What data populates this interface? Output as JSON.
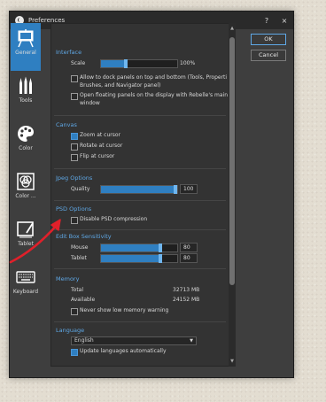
{
  "window": {
    "title": "Preferences",
    "help": "?",
    "close": "×"
  },
  "sidebar": {
    "items": [
      {
        "label": "General",
        "icon": "easel-icon"
      },
      {
        "label": "Tools",
        "icon": "brushes-icon"
      },
      {
        "label": "Color",
        "icon": "palette-icon"
      },
      {
        "label": "Color ...",
        "icon": "color-mix-icon"
      },
      {
        "label": "Tablet",
        "icon": "tablet-icon"
      },
      {
        "label": "Keyboard",
        "icon": "keyboard-icon"
      }
    ]
  },
  "interface": {
    "heading": "Interface",
    "scale_label": "Scale",
    "scale_value": "100%",
    "scale_level": 0.35,
    "dock_panels": "Allow to dock panels on top and bottom (Tools, Properti",
    "dock_panels_2": "Brushes, and Navigator panel)",
    "floating_panels": "Open floating panels on the display with Rebelle's main",
    "floating_panels_2": "window"
  },
  "canvas": {
    "heading": "Canvas",
    "zoom": "Zoom at cursor",
    "rotate": "Rotate at cursor",
    "flip": "Flip at cursor"
  },
  "jpeg": {
    "heading": "Jpeg Options",
    "quality_label": "Quality",
    "quality_value": "100",
    "quality_level": 1.0
  },
  "psd": {
    "heading": "PSD Options",
    "disable": "Disable PSD compression"
  },
  "editbox": {
    "heading": "Edit Box Sensitivity",
    "mouse_label": "Mouse",
    "mouse_value": "80",
    "mouse_level": 0.8,
    "tablet_label": "Tablet",
    "tablet_value": "80",
    "tablet_level": 0.8
  },
  "memory": {
    "heading": "Memory",
    "total_label": "Total",
    "total_value": "32713 MB",
    "available_label": "Available",
    "available_value": "24152 MB",
    "never_show": "Never show low memory warning"
  },
  "language": {
    "heading": "Language",
    "selected": "English",
    "update": "Update languages automatically"
  },
  "buttons": {
    "ok": "OK",
    "cancel": "Cancel"
  },
  "colors": {
    "accent": "#2f7fc1",
    "section": "#5fa8e6",
    "annotation_arrow": "#e0202a"
  }
}
